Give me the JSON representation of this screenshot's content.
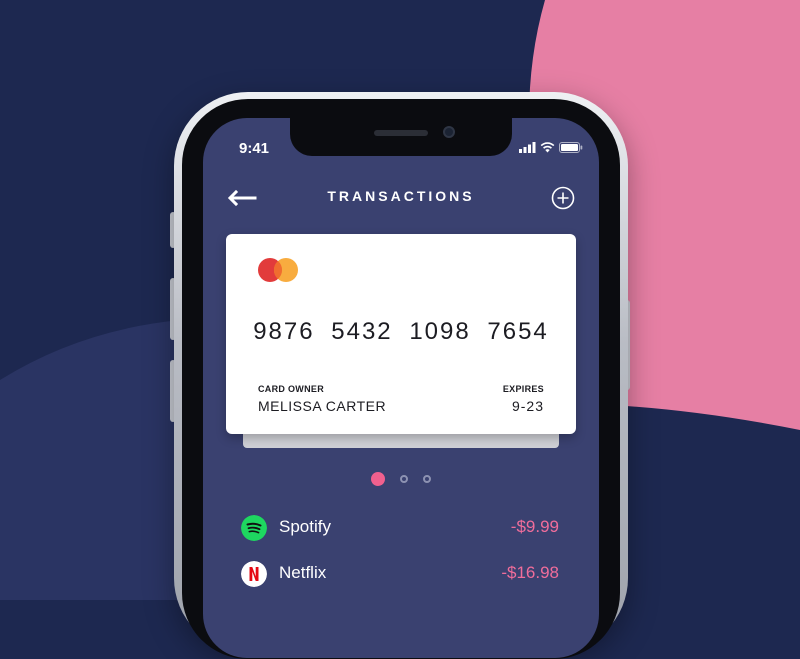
{
  "status_bar": {
    "time": "9:41"
  },
  "header": {
    "title": "TRANSACTIONS"
  },
  "card": {
    "number": "9876  5432  1098  7654",
    "owner_label": "CARD OWNER",
    "owner_name": "MELISSA CARTER",
    "expires_label": "EXPIRES",
    "expires_value": "9-23",
    "brand_icon": "mastercard-logo"
  },
  "pager": {
    "total": 3,
    "active_index": 0
  },
  "transactions": [
    {
      "name": "Spotify",
      "amount": "-$9.99",
      "icon": "spotify-icon"
    },
    {
      "name": "Netflix",
      "amount": "-$16.98",
      "icon": "netflix-icon"
    }
  ],
  "colors": {
    "background_navy": "#1d2850",
    "background_pink": "#e67fa4",
    "screen": "#3a4170",
    "accent_pink": "#f0608e",
    "amount": "#f06d9b"
  }
}
